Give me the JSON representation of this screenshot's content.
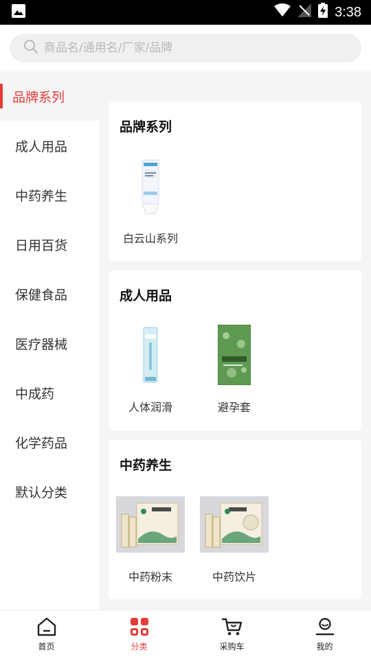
{
  "status_bar": {
    "time": "3:38"
  },
  "search": {
    "placeholder": "商品名/通用名/厂家/品牌"
  },
  "sidebar": {
    "items": [
      {
        "label": "品牌系列",
        "active": true
      },
      {
        "label": "成人用品"
      },
      {
        "label": "中药养生"
      },
      {
        "label": "日用百货"
      },
      {
        "label": "保健食品"
      },
      {
        "label": "医疗器械"
      },
      {
        "label": "中成药"
      },
      {
        "label": "化学药品"
      },
      {
        "label": "默认分类"
      }
    ]
  },
  "sections": [
    {
      "title": "品牌系列",
      "products": [
        {
          "label": "白云山系列"
        }
      ]
    },
    {
      "title": "成人用品",
      "products": [
        {
          "label": "人体润滑"
        },
        {
          "label": "避孕套"
        }
      ]
    },
    {
      "title": "中药养生",
      "products": [
        {
          "label": "中药粉末"
        },
        {
          "label": "中药饮片"
        }
      ]
    }
  ],
  "tab_bar": {
    "tabs": [
      {
        "label": "首页",
        "icon": "home-icon"
      },
      {
        "label": "分类",
        "icon": "category-icon",
        "active": true
      },
      {
        "label": "采购车",
        "icon": "cart-icon"
      },
      {
        "label": "我的",
        "icon": "profile-icon"
      }
    ]
  },
  "colors": {
    "accent": "#e33d3a",
    "background": "#f5f5f5"
  }
}
